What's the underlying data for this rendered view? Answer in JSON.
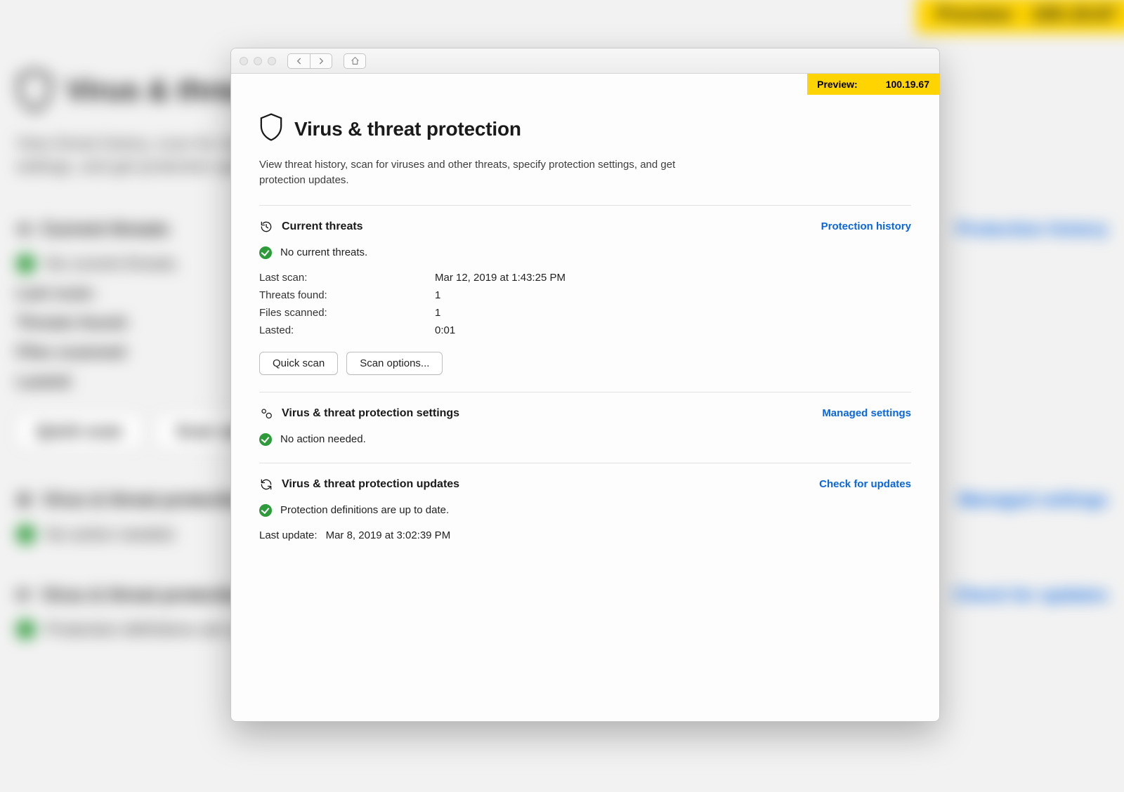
{
  "preview": {
    "label": "Preview:",
    "version": "100.19.67"
  },
  "page": {
    "title": "Virus & threat protection",
    "description": "View threat history, scan for viruses and other threats, specify protection settings, and get protection updates."
  },
  "sections": {
    "current_threats": {
      "title": "Current threats",
      "action": "Protection history",
      "status": "No current threats.",
      "kv": {
        "last_scan_label": "Last scan:",
        "last_scan_value": "Mar 12, 2019 at 1:43:25 PM",
        "threats_found_label": "Threats found:",
        "threats_found_value": "1",
        "files_scanned_label": "Files scanned:",
        "files_scanned_value": "1",
        "lasted_label": "Lasted:",
        "lasted_value": "0:01"
      },
      "buttons": {
        "quick_scan": "Quick scan",
        "scan_options": "Scan options..."
      }
    },
    "settings": {
      "title": "Virus & threat protection settings",
      "action": "Managed settings",
      "status": "No action needed."
    },
    "updates": {
      "title": "Virus & threat protection updates",
      "action": "Check for updates",
      "status": "Protection definitions are up to date.",
      "last_update_label": "Last update:",
      "last_update_value": "Mar 8, 2019 at 3:02:39 PM"
    }
  }
}
